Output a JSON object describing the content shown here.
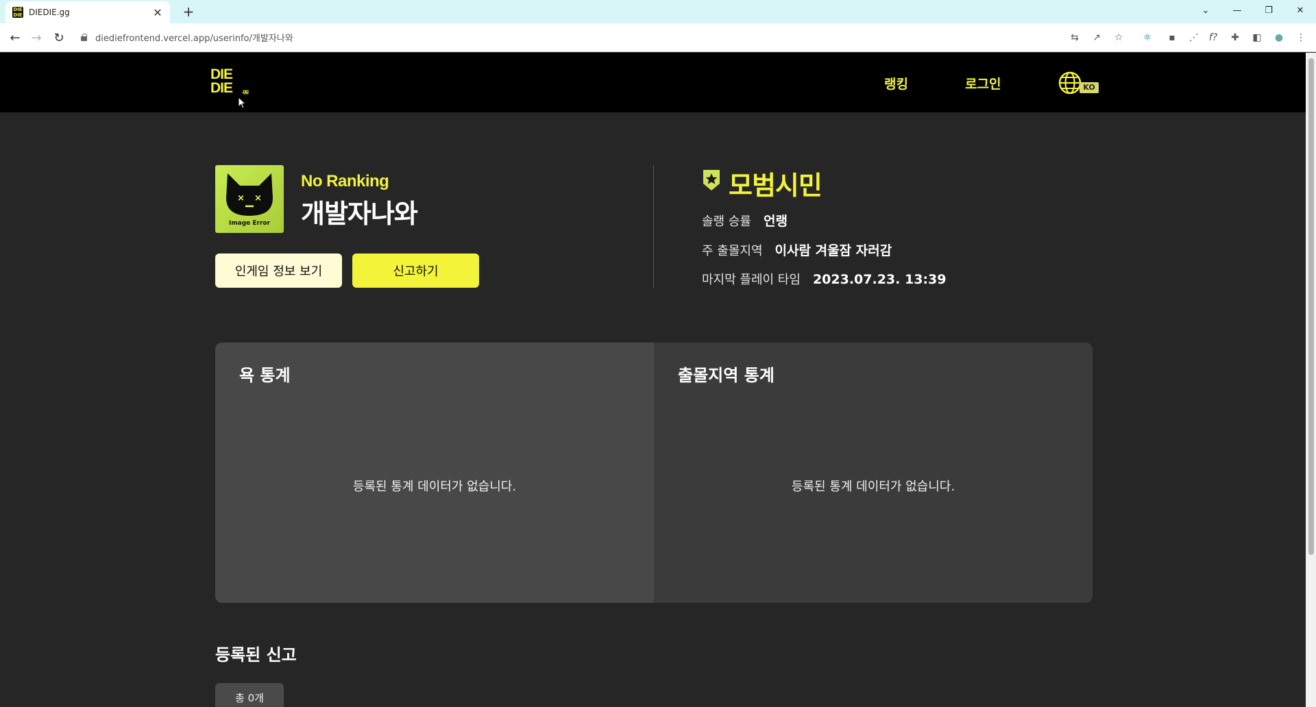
{
  "browser": {
    "tab_title": "DIEDIE.gg",
    "favicon_text_top": "DIE",
    "favicon_text_bottom": "DIE",
    "url": "diediefrontend.vercel.app/userinfo/개발자나와"
  },
  "header": {
    "logo_line1": "DIE",
    "logo_line2": "DIE",
    "logo_suffix": ".gg",
    "nav": {
      "ranking": "랭킹",
      "login": "로그인"
    },
    "language_badge": "KO",
    "accent_color": "#f3f33a"
  },
  "profile": {
    "avatar_caption": "Image Error",
    "rank": "No Ranking",
    "username": "개발자나와",
    "buttons": {
      "ingame_info": "인게임 정보 보기",
      "report": "신고하기"
    },
    "grade": "모범시민",
    "details": [
      {
        "label": "솔랭 승률",
        "value": "언랭"
      },
      {
        "label": "주 출몰지역",
        "value": "이사람 겨울잠 자러감"
      },
      {
        "label": "마지막 플레이 타임",
        "value": "2023.07.23. 13:39"
      }
    ]
  },
  "stats": {
    "profanity": {
      "title": "욕 통계",
      "empty": "등록된 통계 데이터가 없습니다."
    },
    "region": {
      "title": "출몰지역 통계",
      "empty": "등록된 통계 데이터가 없습니다."
    }
  },
  "reports": {
    "title": "등록된 신고",
    "count_label": "총 0개"
  }
}
